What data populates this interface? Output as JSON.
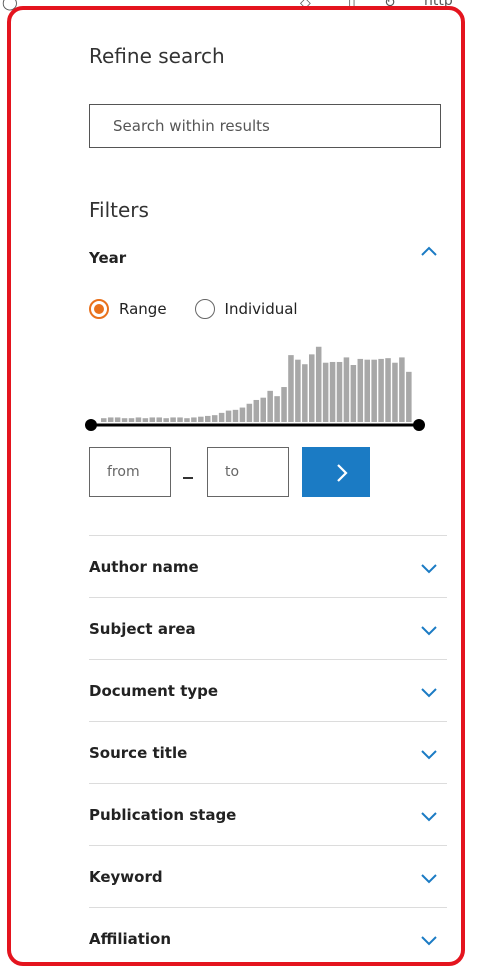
{
  "panel": {
    "title": "Refine search",
    "search": {
      "placeholder": "Search within results",
      "value": ""
    },
    "filters_heading": "Filters",
    "year": {
      "label": "Year",
      "expanded": true,
      "mode_options": [
        {
          "label": "Range",
          "selected": true
        },
        {
          "label": "Individual",
          "selected": false
        }
      ],
      "histogram_relative_counts": [
        0.05,
        0.06,
        0.06,
        0.05,
        0.05,
        0.06,
        0.05,
        0.06,
        0.06,
        0.05,
        0.06,
        0.06,
        0.05,
        0.06,
        0.07,
        0.08,
        0.09,
        0.12,
        0.15,
        0.16,
        0.19,
        0.24,
        0.29,
        0.32,
        0.41,
        0.34,
        0.46,
        0.88,
        0.82,
        0.76,
        0.89,
        0.99,
        0.78,
        0.79,
        0.79,
        0.85,
        0.75,
        0.83,
        0.82,
        0.82,
        0.83,
        0.84,
        0.78,
        0.85,
        0.66
      ],
      "from_placeholder": "from",
      "to_placeholder": "to",
      "dash": "–"
    },
    "accordion": [
      {
        "label": "Author name"
      },
      {
        "label": "Subject area"
      },
      {
        "label": "Document type"
      },
      {
        "label": "Source title"
      },
      {
        "label": "Publication stage"
      },
      {
        "label": "Keyword"
      },
      {
        "label": "Affiliation"
      }
    ]
  },
  "colors": {
    "accent_blue": "#1b7bc4",
    "radio_orange": "#e9711c",
    "highlight_border": "#e4141e",
    "bar_gray": "#a8a8a8"
  },
  "icons": {
    "year_toggle": "chevron-up-icon",
    "accordion_toggle": "chevron-down-icon",
    "apply": "chevron-right-icon"
  }
}
